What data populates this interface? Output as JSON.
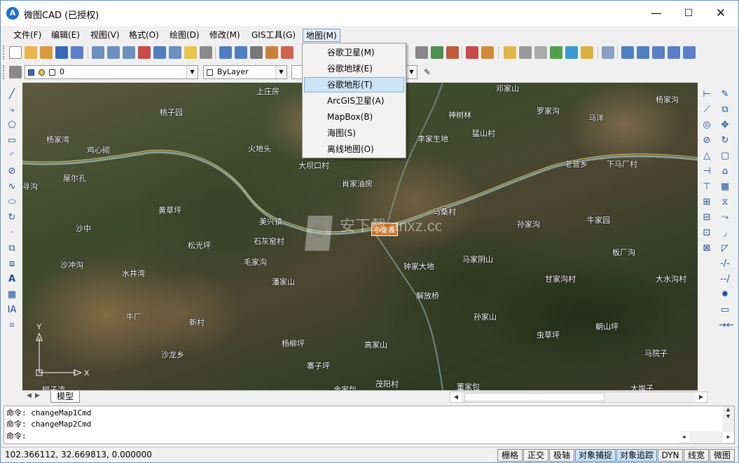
{
  "window": {
    "title": "微图CAD (已授权)",
    "logo_letter": "A",
    "minimize": "—",
    "maximize": "☐",
    "close": "✕"
  },
  "menu": [
    "文件(F)",
    "编辑(E)",
    "视图(V)",
    "格式(O)",
    "绘图(D)",
    "修改(M)",
    "GIS工具(G)",
    "地图(M)"
  ],
  "map_menu": {
    "items": [
      "谷歌卫星(M)",
      "谷歌地球(E)",
      "谷歌地形(T)",
      "ArcGIS卫星(A)",
      "MapBox(B)",
      "海图(S)",
      "离线地图(O)"
    ],
    "selected_index": 2
  },
  "layer_toolbar": {
    "layer_value": "0",
    "color_value": "ByLayer"
  },
  "map": {
    "places": [
      "上庄房",
      "桃子园",
      "杨家湾",
      "鸡心砌",
      "火地头",
      "大坝口村",
      "屋尔孔",
      "寻沟",
      "黄草坪",
      "美兴镇",
      "石灰窑村",
      "沙中",
      "松光坪",
      "毛家沟",
      "沙冲沟",
      "水井湾",
      "潘家山",
      "牛厂",
      "新村",
      "杨柳坪",
      "沙龙乡",
      "高家山",
      "寨子坪",
      "茂阳村",
      "余家包",
      "柳子湾",
      "肖家油房",
      "马桑村",
      "钟家大地",
      "马家阴山",
      "解放桥",
      "孙家山",
      "邓家山",
      "神树林",
      "罗家沟",
      "马洋",
      "猛山村",
      "老营乡",
      "下马厂村",
      "杨家沟",
      "孙家沟",
      "牛家园",
      "板厂沟",
      "甘家沟村",
      "大水沟村",
      "虫草坪",
      "朝山坪",
      "马院子",
      "董家包",
      "大岸子",
      "李家生地"
    ],
    "town_badge": "小金县",
    "axis_y": "Y",
    "axis_x": "X",
    "watermark": "安下载 anxz.com"
  },
  "tabs": {
    "active": "模型"
  },
  "command": {
    "lines": [
      "命令: changeMap1Cmd",
      "命令: changeMap2Cmd",
      "命令:"
    ]
  },
  "status": {
    "coordinates": "102.366112,  32.669813,  0.000000",
    "buttons": [
      "栅格",
      "正交",
      "极轴",
      "对象捕捉",
      "对象追踪",
      "DYN",
      "线宽",
      "微图"
    ],
    "active_buttons": [
      "对象捕捉",
      "对象追踪"
    ]
  },
  "colors": {
    "accent": "#1f6fd0",
    "menu_highlight": "#cde4f7",
    "town_badge": "#c8762a"
  }
}
